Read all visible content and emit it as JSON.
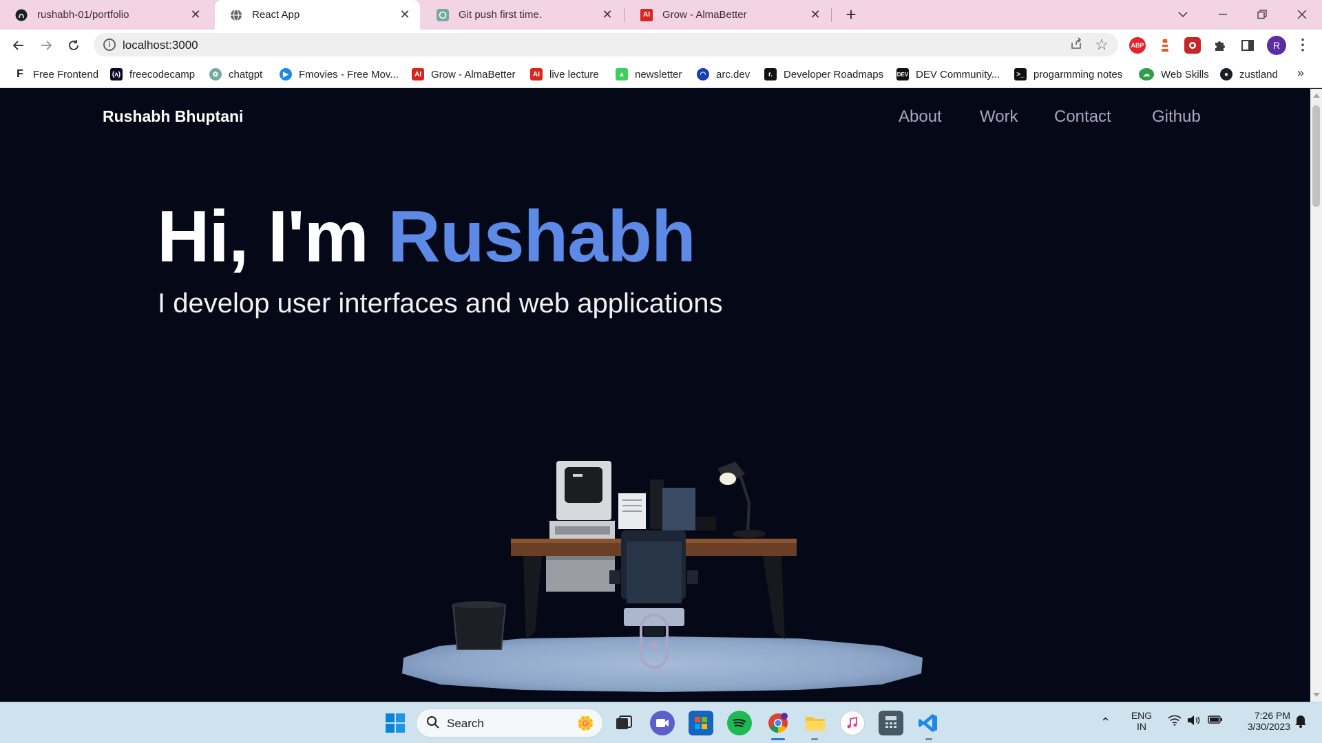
{
  "browser": {
    "tabs": [
      {
        "title": "rushabh-01/portfolio",
        "icon": "github-icon",
        "active": false
      },
      {
        "title": "React App",
        "icon": "globe-icon",
        "active": true
      },
      {
        "title": "Git push first time.",
        "icon": "chatgpt-icon",
        "active": false
      },
      {
        "title": "Grow - AlmaBetter",
        "icon": "almabetter-icon",
        "active": false
      }
    ],
    "new_tab_label": "+",
    "address": "localhost:3000",
    "profile_initial": "R",
    "abp_label": "ABP"
  },
  "bookmarks": [
    {
      "label": "Free Frontend",
      "icon": "freefrontend-icon"
    },
    {
      "label": "freecodecamp",
      "icon": "freecodecamp-icon"
    },
    {
      "label": "chatgpt",
      "icon": "chatgpt-icon"
    },
    {
      "label": "Fmovies - Free Mov...",
      "icon": "fmovies-icon"
    },
    {
      "label": "Grow - AlmaBetter",
      "icon": "almabetter-icon"
    },
    {
      "label": "live lecture",
      "icon": "almabetter-icon"
    },
    {
      "label": "newsletter",
      "icon": "newsletter-icon"
    },
    {
      "label": "arc.dev",
      "icon": "arcdev-icon"
    },
    {
      "label": "Developer Roadmaps",
      "icon": "roadmap-icon"
    },
    {
      "label": "DEV Community...",
      "icon": "dev-icon"
    },
    {
      "label": "progarmming notes",
      "icon": "terminal-icon"
    },
    {
      "label": "Web Skills",
      "icon": "webskills-icon"
    },
    {
      "label": "zustland",
      "icon": "github-icon"
    }
  ],
  "site": {
    "brand": "Rushabh Bhuptani",
    "nav": [
      "About",
      "Work",
      "Contact",
      "Github"
    ],
    "hero_prefix": "Hi, I'm ",
    "hero_name": "Rushabh",
    "hero_subtitle": "I develop user interfaces and web applications",
    "accent_color": "#5d8ae6",
    "background_color": "#050816"
  },
  "taskbar": {
    "search_placeholder": "Search",
    "language_line1": "ENG",
    "language_line2": "IN",
    "time": "7:26 PM",
    "date": "3/30/2023",
    "apps": [
      "start-icon",
      "search",
      "task-view-icon",
      "teams-icon",
      "store-icon",
      "spotify-icon",
      "chrome-icon",
      "file-explorer-icon",
      "itunes-icon",
      "calculator-icon",
      "vscode-icon"
    ]
  }
}
